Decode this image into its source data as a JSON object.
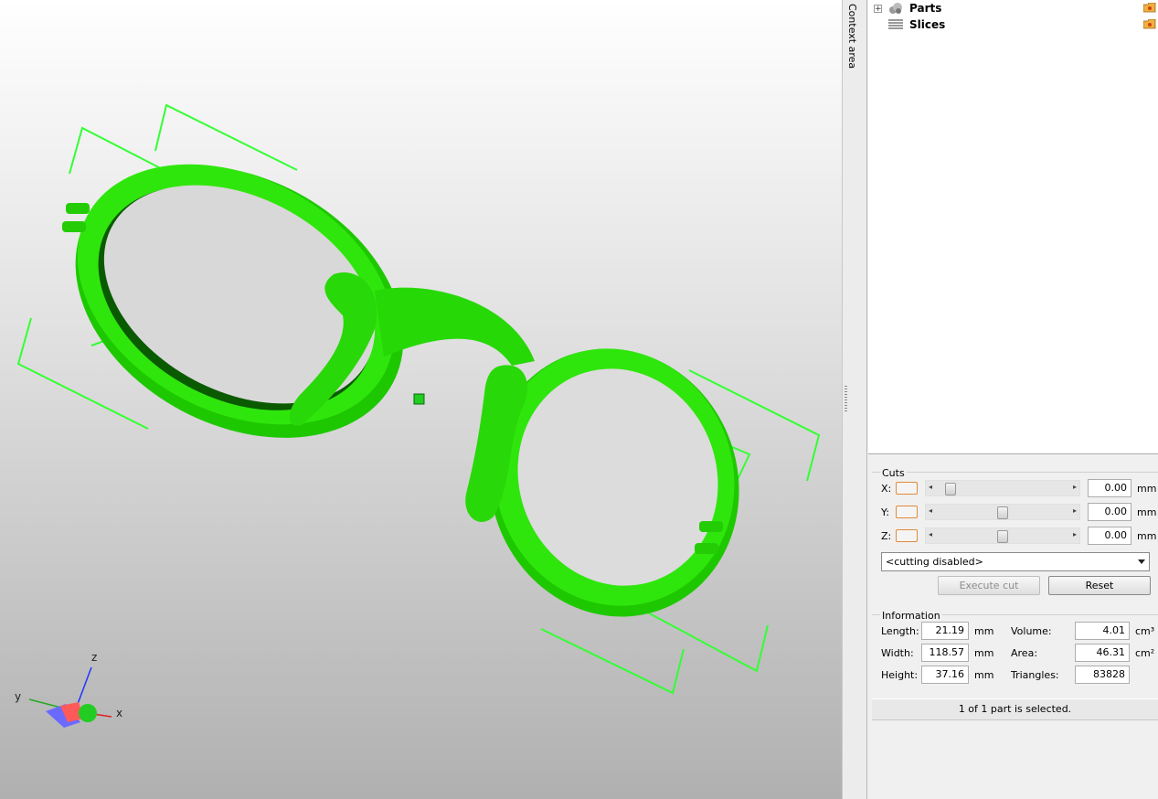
{
  "viewport": {
    "model_color": "#22dd00",
    "bbox_color": "#33ff33",
    "axes": {
      "x_label": "x",
      "y_label": "y",
      "z_label": "z"
    }
  },
  "context_strip": {
    "label": "Context area"
  },
  "tree": {
    "items": [
      {
        "label": "Parts",
        "icon": "parts-icon",
        "expander": "+"
      },
      {
        "label": "Slices",
        "icon": "slices-icon"
      }
    ]
  },
  "cuts": {
    "title": "Cuts",
    "axes": [
      {
        "label": "X:",
        "value": "0.00",
        "unit": "mm",
        "slider_fraction": 0.07
      },
      {
        "label": "Y:",
        "value": "0.00",
        "unit": "mm",
        "slider_fraction": 0.5
      },
      {
        "label": "Z:",
        "value": "0.00",
        "unit": "mm",
        "slider_fraction": 0.5
      }
    ],
    "mode_select": "<cutting disabled>",
    "execute_label": "Execute cut",
    "reset_label": "Reset"
  },
  "information": {
    "title": "Information",
    "length_label": "Length:",
    "length_value": "21.19",
    "length_unit": "mm",
    "width_label": "Width:",
    "width_value": "118.57",
    "width_unit": "mm",
    "height_label": "Height:",
    "height_value": "37.16",
    "height_unit": "mm",
    "volume_label": "Volume:",
    "volume_value": "4.01",
    "volume_unit": "cm³",
    "area_label": "Area:",
    "area_value": "46.31",
    "area_unit": "cm²",
    "triangles_label": "Triangles:",
    "triangles_value": "83828"
  },
  "status": "1 of 1 part is selected."
}
